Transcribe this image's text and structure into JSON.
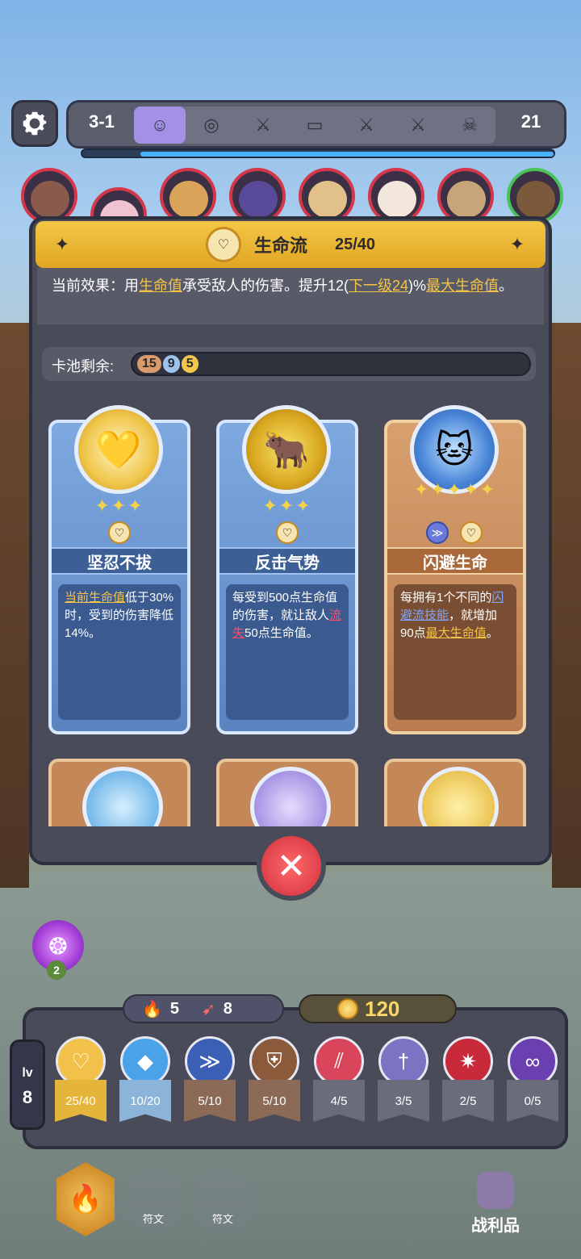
{
  "top": {
    "stage": "3-1",
    "count": "21",
    "nodes": [
      {
        "icon": "face-icon",
        "glyph": "☺"
      },
      {
        "icon": "target-icon",
        "glyph": "◎"
      },
      {
        "icon": "swords-icon",
        "glyph": "⚔"
      },
      {
        "icon": "chest-icon",
        "glyph": "▭"
      },
      {
        "icon": "swords-icon",
        "glyph": "⚔"
      },
      {
        "icon": "swords-icon",
        "glyph": "⚔"
      },
      {
        "icon": "boss-icon",
        "glyph": "☠"
      }
    ]
  },
  "panel": {
    "title": "生命流",
    "progress": "25/40",
    "effect_prefix": "当前效果：用",
    "effect_hl1": "生命值",
    "effect_mid": "承受敌人的伤害。提升12(",
    "effect_next": "下一级24",
    "effect_end": ")%",
    "effect_hl2": "最大生命值",
    "effect_tail": "。",
    "pool_label": "卡池剩余:",
    "pool": [
      "15",
      "9",
      "5"
    ]
  },
  "cards": [
    {
      "name": "坚忍不拔",
      "stars": "✦✦✦",
      "desc_hl": "当前生命值",
      "desc": "低于30%时，受到的伤害降低14%。"
    },
    {
      "name": "反击气势",
      "stars": "✦✦✦",
      "desc_pre": "每受到500点生命值的伤害，就让敌人",
      "desc_hl": "流失",
      "desc_post": "50点生命值。"
    },
    {
      "name": "闪避生命",
      "stars": "✦✦✦✦✦",
      "desc_pre": "每拥有1个不同的",
      "desc_hl": "闪避流技能",
      "desc_mid": "，就增加90点",
      "desc_hl2": "最大生命值",
      "desc_post": "。"
    }
  ],
  "bottom": {
    "orb_count": "2",
    "mana": "5",
    "attack": "8",
    "gold": "120",
    "lv_label": "lv",
    "lv": "8",
    "traits": [
      {
        "label": "25/40",
        "color": "#f2c14a",
        "icon": "heart-icon",
        "glyph": "♡"
      },
      {
        "label": "10/20",
        "color": "#4aa3e8",
        "icon": "drop-icon",
        "glyph": "💧"
      },
      {
        "label": "5/10",
        "color": "#3b5fb5",
        "icon": "boot-icon",
        "glyph": "≫"
      },
      {
        "label": "5/10",
        "color": "#8a5a3a",
        "icon": "shield-icon",
        "glyph": "⛨"
      },
      {
        "label": "4/5",
        "color": "#d9455a",
        "icon": "claw-icon",
        "glyph": "///"
      },
      {
        "label": "3/5",
        "color": "#7a74c2",
        "icon": "sword-icon",
        "glyph": "†"
      },
      {
        "label": "2/5",
        "color": "#c92a3a",
        "icon": "burst-icon",
        "glyph": "✷"
      },
      {
        "label": "0/5",
        "color": "#6a3fb0",
        "icon": "swirl-icon",
        "glyph": "∞"
      }
    ],
    "rune1": "符文",
    "rune2": "符文",
    "loot": "战利品"
  }
}
